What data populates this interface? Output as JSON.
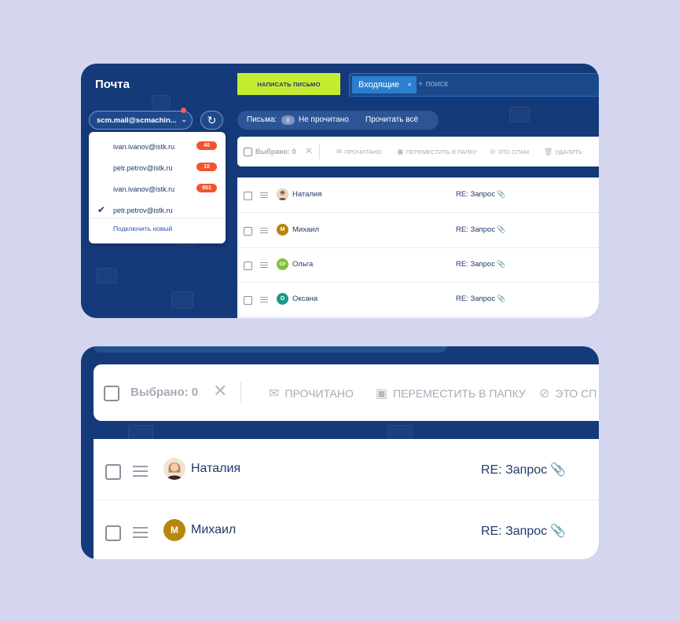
{
  "app": {
    "title": "Почта"
  },
  "compose": {
    "label": "НАПИСАТЬ ПИСЬМО"
  },
  "search": {
    "chip": "Входящие",
    "chip_close": "×",
    "placeholder": "+ поиск"
  },
  "account": {
    "current": "scm.mail@scmachin...",
    "chevron": "⌄",
    "refresh_icon": "↻"
  },
  "dropdown": {
    "items": [
      {
        "email": "ivan.ivanov@istk.ru",
        "badge": "40",
        "checked": false
      },
      {
        "email": "petr.petrov@istk.ru",
        "badge": "10",
        "checked": false
      },
      {
        "email": "ivan.ivanov@istk.ru",
        "badge": "901",
        "checked": false
      },
      {
        "email": "petr.petrov@istk.ru",
        "badge": "",
        "checked": true
      }
    ],
    "check_icon": "✔",
    "connect_new": "Подключить новый"
  },
  "filter": {
    "label": "Письма:",
    "count": "0",
    "unread": "Не прочитано",
    "read_all": "Прочитать всё"
  },
  "toolbar": {
    "selected": "Выбрано: 0",
    "clear_icon": "✕",
    "read": "ПРОЧИТАНО",
    "move": "ПЕРЕМЕСТИТЬ В ПАПКУ",
    "spam": "ЭТО СПАМ",
    "spam_short": "ЭТО СП",
    "delete": "УДАЛИТЬ",
    "icons": {
      "read": "✉",
      "move": "▣",
      "spam": "⊘",
      "delete": "🗑"
    }
  },
  "messages": [
    {
      "name": "Наталия",
      "avatar": "photo",
      "initials": "",
      "color": "#c99a6a",
      "subject": "RE: Запрос"
    },
    {
      "name": "Михаил",
      "avatar": "initial",
      "initials": "М",
      "color": "#b8860b",
      "subject": "RE: Запрос"
    },
    {
      "name": "Ольга",
      "avatar": "initial",
      "initials": "ОУ",
      "color": "#7fbf3a",
      "subject": "RE: Запрос"
    },
    {
      "name": "Оксана",
      "avatar": "initial",
      "initials": "О",
      "color": "#1a9a8a",
      "subject": "RE: Запрос"
    }
  ],
  "clip_icon": "📎",
  "colors": {
    "background": "#d4d6ef",
    "navy": "#153a7a",
    "accent_green": "#c6ec31",
    "badge_red": "#f2542d",
    "chip_blue": "#2a7fd1"
  }
}
